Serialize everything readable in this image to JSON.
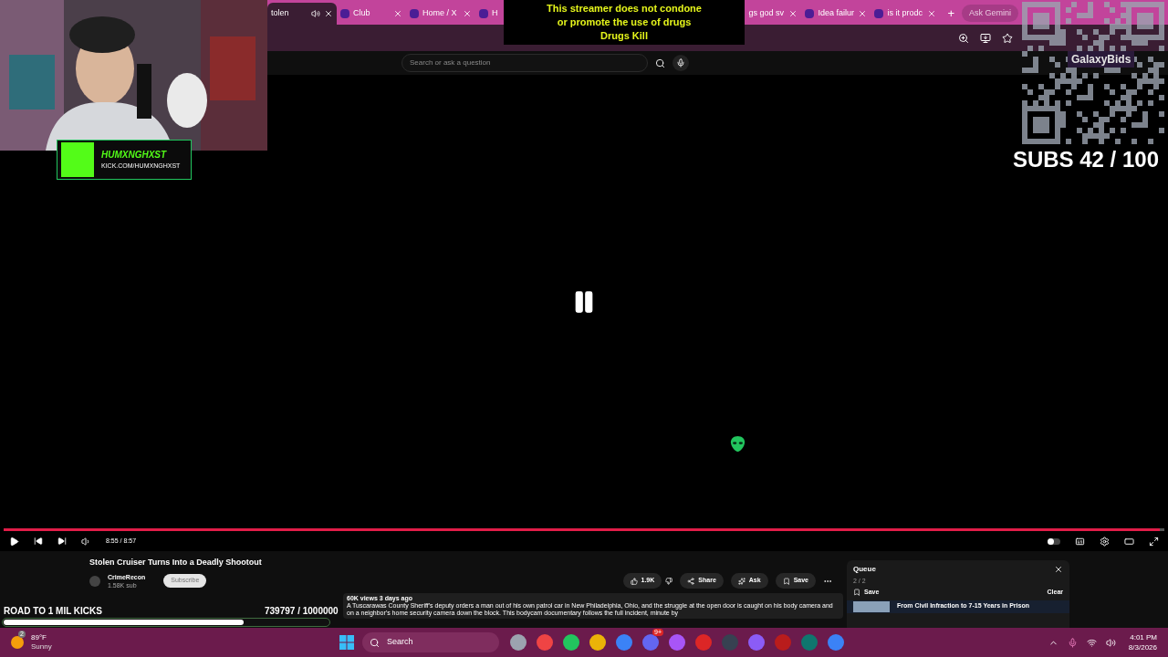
{
  "browser": {
    "tabs": [
      {
        "label": "tolen",
        "selected": true,
        "audio": true,
        "favicon": false,
        "closable": true
      },
      {
        "label": "Club",
        "selected": false,
        "audio": false,
        "favicon": true,
        "closable": true
      },
      {
        "label": "Home / X",
        "selected": false,
        "audio": false,
        "favicon": true,
        "closable": true
      },
      {
        "label": "H",
        "selected": false,
        "audio": false,
        "favicon": true,
        "closable": false
      },
      {
        "label": "gs god sv",
        "selected": false,
        "audio": false,
        "favicon": false,
        "closable": true
      },
      {
        "label": "Idea failur",
        "selected": false,
        "audio": false,
        "favicon": true,
        "closable": true
      },
      {
        "label": "is it prodc",
        "selected": false,
        "audio": false,
        "favicon": true,
        "closable": true
      }
    ],
    "new_tab": "+",
    "ask": "Ask Gemini",
    "search_placeholder": "Search or ask a question"
  },
  "overlay": {
    "banner": [
      "This streamer does not condone",
      "or promote the use of drugs",
      "Drugs Kill"
    ],
    "streamer": "HUMXNGHXST",
    "streamer_url": "KICK.COM/HUMXNGHXST",
    "sponsor": "GalaxyBids",
    "subs": "SUBS 42 / 100",
    "goal_label": "ROAD TO 1 MIL KICKS",
    "goal_count": "739797 / 1000000",
    "goal": {
      "level": 0.74
    }
  },
  "player": {
    "paused": true,
    "autoplay": false,
    "progress": {
      "level": 0.996
    },
    "time": "8:55 / 8:57"
  },
  "video": {
    "title": "Stolen Cruiser Turns Into a Deadly Shootout",
    "channel": "CrimeRecon",
    "subscribers": "1.58K sub",
    "subscribe": "Subscribe",
    "likes": "1.9K",
    "share": "Share",
    "ask": "Ask",
    "save": "Save",
    "meta": "60K views  3 days ago",
    "description": "A Tuscarawas County Sheriff's deputy orders a man out of his own patrol car in New Philadelphia, Ohio, and the struggle at the open door is caught on his body camera and on a neighbor's home security camera down the block. This bodycam documentary follows the full incident, minute by"
  },
  "queue": {
    "title": "Queue",
    "count": "2 / 2",
    "save": "Save",
    "clear": "Clear",
    "items": [
      "From Civil Infraction to 7-15 Years in Prison"
    ]
  },
  "taskbar": {
    "temperature": "89°F",
    "weather": "Sunny",
    "weather_badge": "2",
    "search": "Search",
    "discord_badge": "9+",
    "time": "4:01 PM",
    "date": "8/3/2026"
  }
}
